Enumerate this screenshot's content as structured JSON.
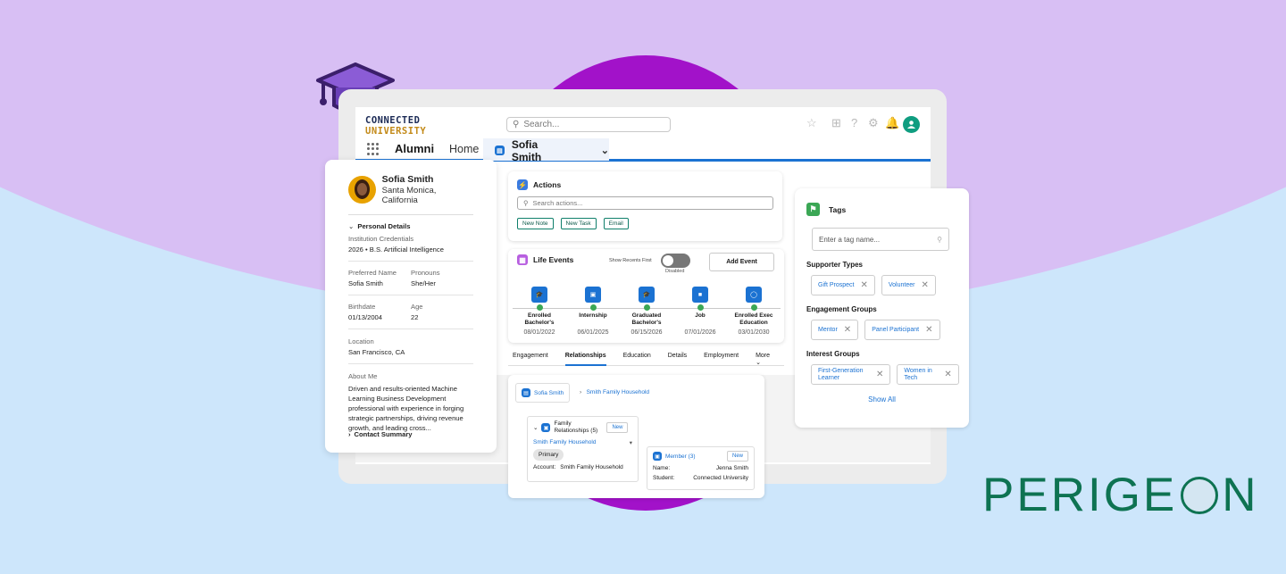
{
  "brand": {
    "line1": "CONNECTED",
    "line2": "UNIVERSITY",
    "partner": "PERIGE",
    "partner_tail": "N"
  },
  "header": {
    "search_placeholder": "Search..."
  },
  "nav": {
    "app_name": "Alumni",
    "home": "Home",
    "active_tab": "Sofia Smith"
  },
  "profile": {
    "name": "Sofia Smith",
    "location": "Santa Monica, California",
    "section": "Personal Details",
    "inst_label": "Institution Credentials",
    "inst_value": "2026 • B.S. Artificial Intelligence",
    "pref_label": "Preferred Name",
    "pref_value": "Sofia Smith",
    "pron_label": "Pronouns",
    "pron_value": "She/Her",
    "birth_label": "Birthdate",
    "birth_value": "01/13/2004",
    "age_label": "Age",
    "age_value": "22",
    "loc_label": "Location",
    "loc_value": "San Francisco, CA",
    "about_label": "About Me",
    "about_value": "Driven and results-oriented Machine Learning Business Development professional with experience in forging strategic partnerships, driving revenue growth, and leading cross...",
    "contact": "Contact Summary"
  },
  "actions": {
    "title": "Actions",
    "search_placeholder": "Search actions...",
    "buttons": [
      "New Note",
      "New Task",
      "Email"
    ]
  },
  "life_events": {
    "title": "Life Events",
    "show_recent": "Show Recents First",
    "toggle_state": "Disabled",
    "add": "Add Event",
    "items": [
      {
        "name": "Enrolled Bachelor's",
        "date": "08/01/2022",
        "icon": "graduation-cap-icon"
      },
      {
        "name": "Internship",
        "date": "06/01/2025",
        "icon": "building-icon"
      },
      {
        "name": "Graduated Bachelor's",
        "date": "06/15/2026",
        "icon": "graduation-cap-icon"
      },
      {
        "name": "Job",
        "date": "07/01/2026",
        "icon": "briefcase-icon"
      },
      {
        "name": "Enrolled Exec Education",
        "date": "03/01/2030",
        "icon": "award-icon"
      }
    ]
  },
  "record_tabs": [
    "Engagement",
    "Relationships",
    "Education",
    "Details",
    "Employment",
    "More"
  ],
  "relationships": {
    "root": "Sofia Smith",
    "household": "Smith Family Household",
    "family_label": "Family Relationships (5)",
    "new": "New",
    "primary": "Primary",
    "account_label": "Account:",
    "account_value": "Smith Family Household",
    "member_label": "Member (3)",
    "name_label": "Name:",
    "name_value": "Jenna Smith",
    "student_label": "Student:",
    "student_value": "Connected University"
  },
  "tags": {
    "title": "Tags",
    "placeholder": "Enter a tag name...",
    "supporter_label": "Supporter Types",
    "supporter": [
      "Gift Prospect",
      "Volunteer"
    ],
    "engagement_label": "Engagement Groups",
    "engagement": [
      "Mentor",
      "Panel Participant"
    ],
    "interest_label": "Interest Groups",
    "interest": [
      "First-Generation Learner",
      "Women in Tech"
    ],
    "show_all": "Show All"
  },
  "colors": {
    "accent": "#1b72d2",
    "brand_navy": "#1b2a55",
    "brand_gold": "#c38a19",
    "teal": "#0e7352"
  }
}
